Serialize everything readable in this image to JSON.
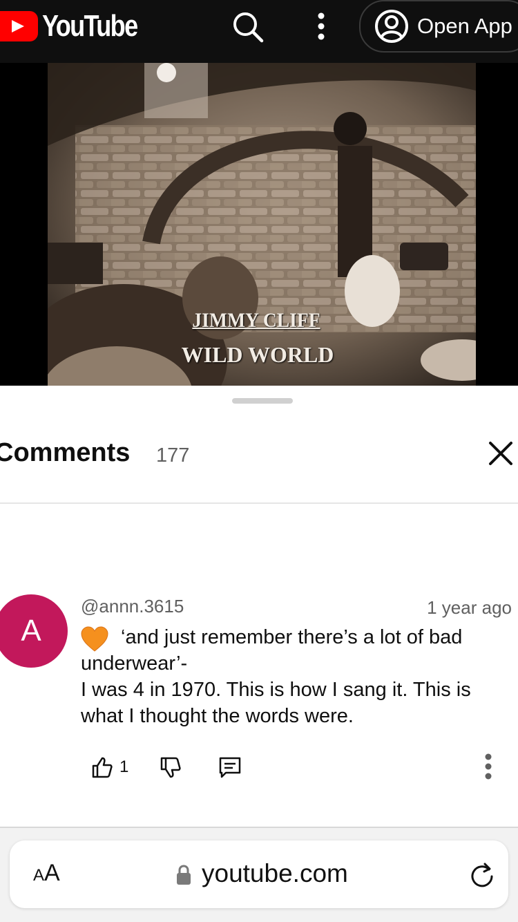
{
  "header": {
    "logo_text": "YouTube",
    "open_app_label": "Open App",
    "icons": [
      "youtube-play-icon",
      "search-icon",
      "more-vert-icon",
      "account-circle-icon"
    ],
    "colors": {
      "background": "#0f0f0f",
      "logo_red": "#ff0000"
    }
  },
  "video": {
    "caption_line1": "JIMMY CLIFF",
    "caption_line2": "WILD WORLD"
  },
  "comments": {
    "title": "Comments",
    "count": "177",
    "close_icon": "close-icon"
  },
  "comment": {
    "avatar_letter": "A",
    "avatar_color": "#c2185b",
    "author": "@annn.3615",
    "time": "1 year ago",
    "emoji_icon": "orange-heart-icon",
    "line1": "‘and just remember there’s a lot  of bad",
    "line2": "underwear’-",
    "line3": "I was 4 in 1970. This is how I sang it. This is",
    "line4": "what I thought the words were.",
    "like_count": "1",
    "action_icons": [
      "thumbs-up-icon",
      "thumbs-down-icon",
      "reply-icon",
      "more-vert-icon"
    ]
  },
  "browser": {
    "text_size_label_small": "A",
    "text_size_label_large": "A",
    "url": "youtube.com",
    "icons": [
      "lock-icon",
      "reload-icon"
    ]
  }
}
